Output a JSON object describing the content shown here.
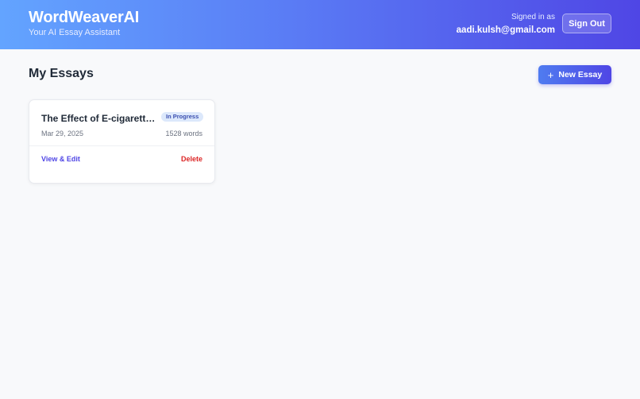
{
  "header": {
    "app_title": "WordWeaverAI",
    "subtitle": "Your AI Essay Assistant",
    "signed_in_label": "Signed in as",
    "user_email": "aadi.kulsh@gmail.com",
    "sign_out_label": "Sign Out"
  },
  "main": {
    "page_title": "My Essays",
    "new_essay_label": "New Essay",
    "new_essay_icon": "plus-icon"
  },
  "essays": [
    {
      "title": "The Effect of E-cigarettes on Youth",
      "status": "In Progress",
      "date": "Mar 29, 2025",
      "words": "1528 words",
      "view_label": "View & Edit",
      "delete_label": "Delete"
    }
  ],
  "colors": {
    "header_gradient_start": "#63a4ff",
    "header_gradient_end": "#4f46e5",
    "accent": "#4f46e5",
    "danger": "#dc2626",
    "badge_bg": "#dce8fb"
  }
}
